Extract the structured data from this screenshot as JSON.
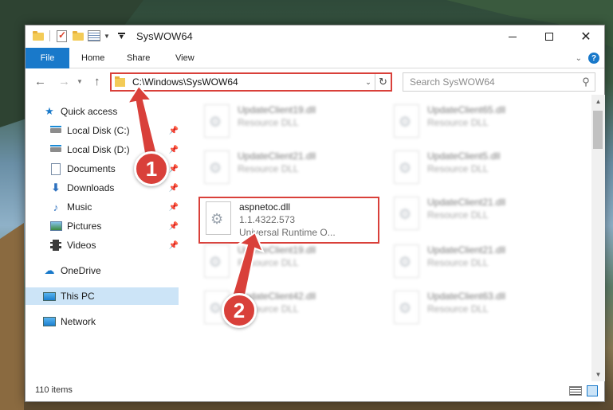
{
  "window": {
    "title": "SysWOW64"
  },
  "ribbon": {
    "tabs": {
      "file": "File",
      "home": "Home",
      "share": "Share",
      "view": "View"
    }
  },
  "address": {
    "path": "C:\\Windows\\SysWOW64"
  },
  "search": {
    "placeholder": "Search SysWOW64"
  },
  "nav": {
    "quick_access": "Quick access",
    "local_c": "Local Disk (C:)",
    "local_d": "Local Disk (D:)",
    "documents": "Documents",
    "downloads": "Downloads",
    "music": "Music",
    "pictures": "Pictures",
    "videos": "Videos",
    "onedrive": "OneDrive",
    "this_pc": "This PC",
    "network": "Network"
  },
  "files": [
    {
      "name": "UpdateClient19.dll",
      "sub": "Resource DLL"
    },
    {
      "name": "UpdateClient65.dll",
      "sub": "Resource DLL"
    },
    {
      "name": "UpdateClient21.dll",
      "sub": "Resource DLL"
    },
    {
      "name": "UpdateClient5.dll",
      "sub": "Resource DLL"
    },
    {
      "name": "aspnetoc.dll",
      "version": "1.1.4322.573",
      "sub": "Universal Runtime O..."
    },
    {
      "name": "UpdateClient21.dll",
      "sub": "Resource DLL"
    },
    {
      "name": "UpdateClient19.dll",
      "sub": "Resource DLL"
    },
    {
      "name": "UpdateClient21.dll",
      "sub": "Resource DLL"
    },
    {
      "name": "UpdateClient42.dll",
      "sub": "Resource DLL"
    },
    {
      "name": "UpdateClient63.dll",
      "sub": "Resource DLL"
    }
  ],
  "status": {
    "count": "110 items"
  },
  "annotations": {
    "badge1": "1",
    "badge2": "2"
  },
  "colors": {
    "accent": "#1979ca",
    "highlight": "#d9403a",
    "selected": "#cce4f7"
  }
}
